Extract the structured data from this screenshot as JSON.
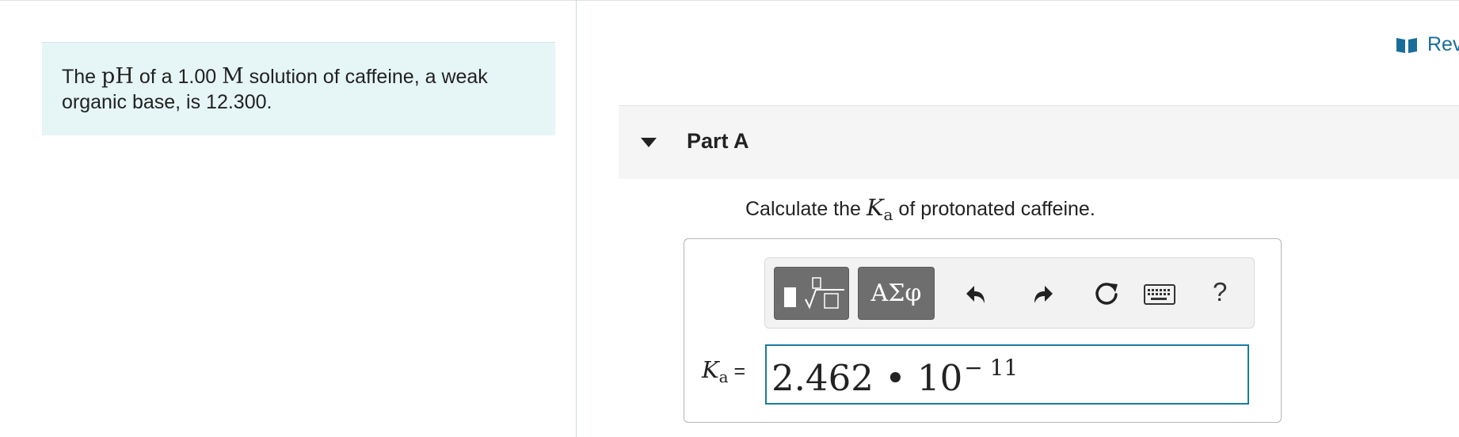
{
  "problem": {
    "text_before_ph": "The ",
    "ph_symbol": "pH",
    "text_mid1": " of a 1.00 ",
    "molar_symbol": "M",
    "text_after": " solution of caffeine, a weak organic base, is 12.300."
  },
  "review": {
    "label": "Rev",
    "icon": "book-icon"
  },
  "part": {
    "title": "Part A",
    "toggle_icon": "triangle-down-icon"
  },
  "question": {
    "prefix": "Calculate the ",
    "k_symbol": "K",
    "k_subscript": "a",
    "suffix": " of protonated caffeine."
  },
  "toolbar": {
    "template_icon": "fraction-radical-template-icon",
    "greek_label": "ΑΣφ",
    "undo_icon": "undo-icon",
    "redo_icon": "redo-icon",
    "reset_icon": "reset-icon",
    "keyboard_icon": "keyboard-icon",
    "help_label": "?"
  },
  "answer": {
    "label_symbol": "K",
    "label_subscript": "a",
    "equals": " =",
    "mantissa": "2.462 • 10",
    "exponent": "− 11"
  },
  "colors": {
    "problem_bg": "#e6f5f5",
    "part_header_bg": "#f5f5f5",
    "link": "#1a6d99",
    "answer_border": "#1a7aa0",
    "toolbar_dark_button": "#6e6e6e"
  }
}
